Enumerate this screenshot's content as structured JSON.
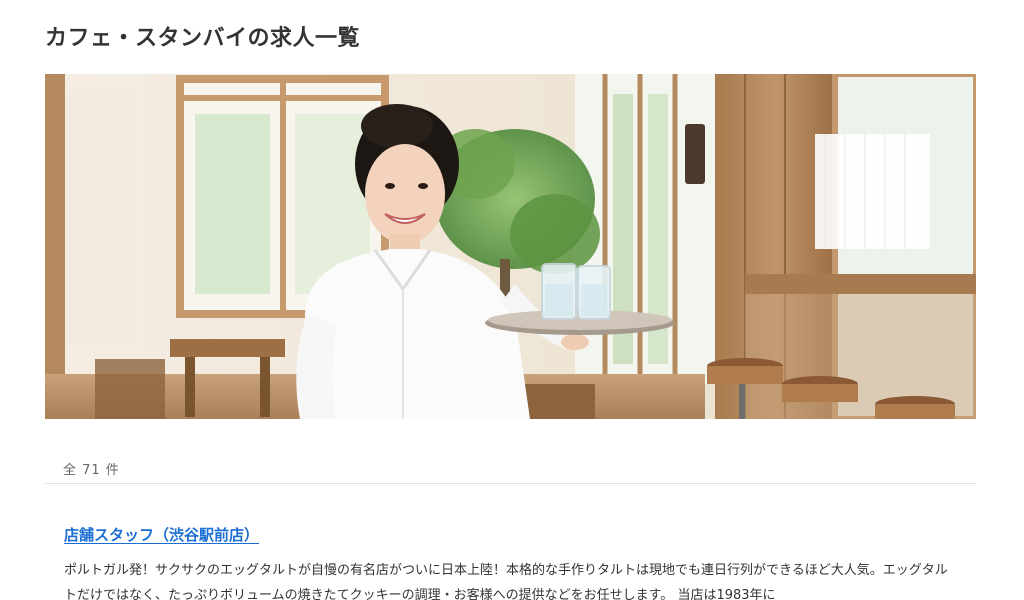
{
  "page": {
    "title": "カフェ・スタンバイの求人一覧"
  },
  "hero": {
    "image_subject": "smiling-waitress-holding-tray-in-cafe"
  },
  "results": {
    "count_text": "全 71 件"
  },
  "jobs": [
    {
      "title": "店舗スタッフ（渋谷駅前店）",
      "description": "ポルトガル発！サクサクのエッグタルトが自慢の有名店がついに日本上陸！本格的な手作りタルトは現地でも連日行列ができるほど大人気。エッグタルトだけではなく、たっぷりボリュームの焼きたてクッキーの調理・お客様への提供などをお任せします。 当店は1983年に"
    }
  ],
  "colors": {
    "link": "#1b6fd3",
    "text": "#333333",
    "muted": "#666666",
    "divider": "#e2e2e2"
  }
}
